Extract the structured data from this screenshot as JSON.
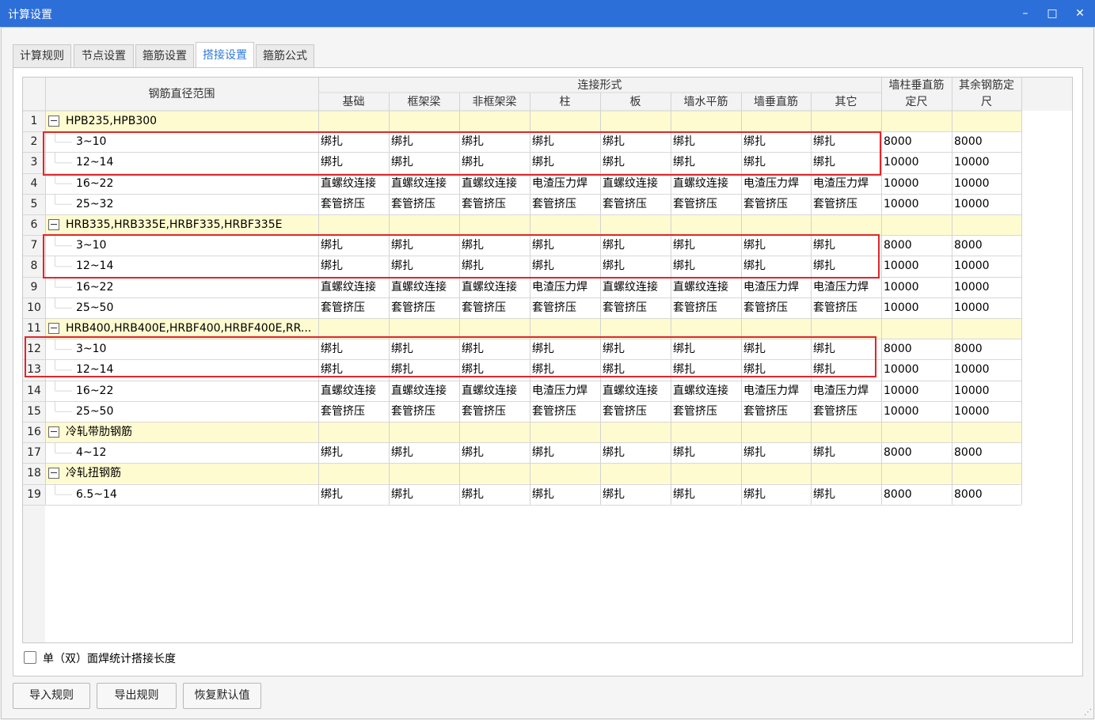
{
  "window": {
    "title": "计算设置",
    "minimize": "–",
    "maximize": "□",
    "close": "✕"
  },
  "tabs": [
    {
      "label": "计算规则",
      "active": false
    },
    {
      "label": "节点设置",
      "active": false
    },
    {
      "label": "箍筋设置",
      "active": false
    },
    {
      "label": "搭接设置",
      "active": true
    },
    {
      "label": "箍筋公式",
      "active": false
    }
  ],
  "table": {
    "diameter_header": "钢筋直径范围",
    "group_header": "连接形式",
    "connection_columns": [
      "基础",
      "框架梁",
      "非框架梁",
      "柱",
      "板",
      "墙水平筋",
      "墙垂直筋",
      "其它"
    ],
    "fixed_length_headers": [
      {
        "line1": "墙柱垂直筋",
        "line2": "定尺"
      },
      {
        "line1": "其余钢筋定",
        "line2": "尺"
      }
    ],
    "rows": [
      {
        "num": "1",
        "type": "group",
        "label": "HPB235,HPB300"
      },
      {
        "num": "2",
        "type": "item",
        "label": "3~10",
        "cells": [
          "绑扎",
          "绑扎",
          "绑扎",
          "绑扎",
          "绑扎",
          "绑扎",
          "绑扎",
          "绑扎",
          "8000",
          "8000"
        ]
      },
      {
        "num": "3",
        "type": "item",
        "label": "12~14",
        "cells": [
          "绑扎",
          "绑扎",
          "绑扎",
          "绑扎",
          "绑扎",
          "绑扎",
          "绑扎",
          "绑扎",
          "10000",
          "10000"
        ]
      },
      {
        "num": "4",
        "type": "item",
        "label": "16~22",
        "cells": [
          "直螺纹连接",
          "直螺纹连接",
          "直螺纹连接",
          "电渣压力焊",
          "直螺纹连接",
          "直螺纹连接",
          "电渣压力焊",
          "电渣压力焊",
          "10000",
          "10000"
        ]
      },
      {
        "num": "5",
        "type": "item",
        "label": "25~32",
        "cells": [
          "套管挤压",
          "套管挤压",
          "套管挤压",
          "套管挤压",
          "套管挤压",
          "套管挤压",
          "套管挤压",
          "套管挤压",
          "10000",
          "10000"
        ]
      },
      {
        "num": "6",
        "type": "group",
        "label": "HRB335,HRB335E,HRBF335,HRBF335E"
      },
      {
        "num": "7",
        "type": "item",
        "label": "3~10",
        "cells": [
          "绑扎",
          "绑扎",
          "绑扎",
          "绑扎",
          "绑扎",
          "绑扎",
          "绑扎",
          "绑扎",
          "8000",
          "8000"
        ]
      },
      {
        "num": "8",
        "type": "item",
        "label": "12~14",
        "cells": [
          "绑扎",
          "绑扎",
          "绑扎",
          "绑扎",
          "绑扎",
          "绑扎",
          "绑扎",
          "绑扎",
          "10000",
          "10000"
        ]
      },
      {
        "num": "9",
        "type": "item",
        "label": "16~22",
        "cells": [
          "直螺纹连接",
          "直螺纹连接",
          "直螺纹连接",
          "电渣压力焊",
          "直螺纹连接",
          "直螺纹连接",
          "电渣压力焊",
          "电渣压力焊",
          "10000",
          "10000"
        ]
      },
      {
        "num": "10",
        "type": "item",
        "label": "25~50",
        "cells": [
          "套管挤压",
          "套管挤压",
          "套管挤压",
          "套管挤压",
          "套管挤压",
          "套管挤压",
          "套管挤压",
          "套管挤压",
          "10000",
          "10000"
        ]
      },
      {
        "num": "11",
        "type": "group",
        "label": "HRB400,HRB400E,HRBF400,HRBF400E,RR..."
      },
      {
        "num": "12",
        "type": "item",
        "label": "3~10",
        "cells": [
          "绑扎",
          "绑扎",
          "绑扎",
          "绑扎",
          "绑扎",
          "绑扎",
          "绑扎",
          "绑扎",
          "8000",
          "8000"
        ]
      },
      {
        "num": "13",
        "type": "item",
        "label": "12~14",
        "cells": [
          "绑扎",
          "绑扎",
          "绑扎",
          "绑扎",
          "绑扎",
          "绑扎",
          "绑扎",
          "绑扎",
          "10000",
          "10000"
        ]
      },
      {
        "num": "14",
        "type": "item",
        "label": "16~22",
        "cells": [
          "直螺纹连接",
          "直螺纹连接",
          "直螺纹连接",
          "电渣压力焊",
          "直螺纹连接",
          "直螺纹连接",
          "电渣压力焊",
          "电渣压力焊",
          "10000",
          "10000"
        ]
      },
      {
        "num": "15",
        "type": "item",
        "label": "25~50",
        "cells": [
          "套管挤压",
          "套管挤压",
          "套管挤压",
          "套管挤压",
          "套管挤压",
          "套管挤压",
          "套管挤压",
          "套管挤压",
          "10000",
          "10000"
        ]
      },
      {
        "num": "16",
        "type": "group",
        "label": "冷轧带肋钢筋"
      },
      {
        "num": "17",
        "type": "item",
        "label": "4~12",
        "cells": [
          "绑扎",
          "绑扎",
          "绑扎",
          "绑扎",
          "绑扎",
          "绑扎",
          "绑扎",
          "绑扎",
          "8000",
          "8000"
        ]
      },
      {
        "num": "18",
        "type": "group",
        "label": "冷轧扭钢筋"
      },
      {
        "num": "19",
        "type": "item",
        "label": "6.5~14",
        "cells": [
          "绑扎",
          "绑扎",
          "绑扎",
          "绑扎",
          "绑扎",
          "绑扎",
          "绑扎",
          "绑扎",
          "8000",
          "8000"
        ]
      }
    ]
  },
  "checkbox": {
    "label": "单（双）面焊统计搭接长度",
    "checked": false
  },
  "buttons": {
    "import": "导入规则",
    "export": "导出规则",
    "restore": "恢复默认值"
  },
  "colors": {
    "titlebar": "#2d6fd9",
    "group_row": "#fffbd0",
    "highlight_box": "#e0262b",
    "active_tab_text": "#2f7ad8"
  }
}
